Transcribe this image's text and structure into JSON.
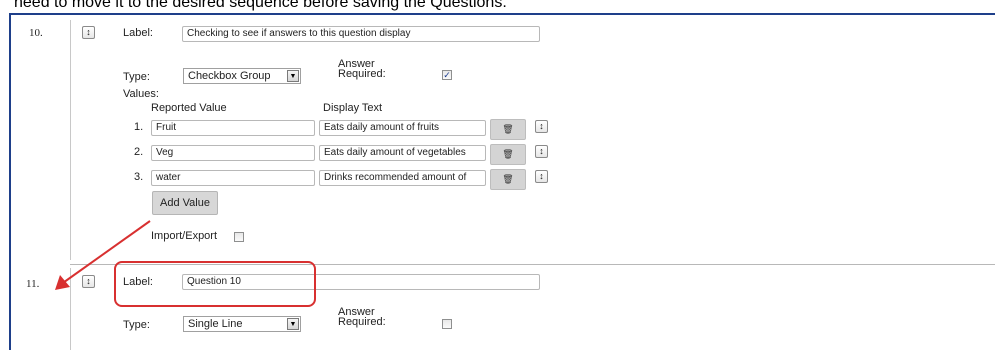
{
  "banner": {
    "text": "need to move it to the desired sequence before saving the Questions."
  },
  "icons": {
    "handle_icon": "updown-arrow-icon",
    "trash_icon": "trash-icon",
    "dropdown_icon": "chevron-down-icon"
  },
  "colors": {
    "annotation_red": "#d83030",
    "frame_blue": "#1e3f8a",
    "check_blue": "#1b3c8f"
  },
  "question10": {
    "number": "10.",
    "label_caption": "Label:",
    "label_value": "Checking to see if answers to this question display",
    "type_caption": "Type:",
    "type_value": "Checkbox Group",
    "answer_required_caption_line1": "Answer",
    "answer_required_caption_line2": "Required:",
    "answer_required_checked": true,
    "values_caption": "Values:",
    "col_reported": "Reported Value",
    "col_display": "Display Text",
    "rows": [
      {
        "num": "1.",
        "reported": "Fruit",
        "display": "Eats daily amount of fruits"
      },
      {
        "num": "2.",
        "reported": "Veg",
        "display": "Eats daily amount of vegetables"
      },
      {
        "num": "3.",
        "reported": "water",
        "display": "Drinks recommended amount of"
      }
    ],
    "add_value_label": "Add Value",
    "import_export_label": "Import/Export",
    "import_export_checked": false
  },
  "question11": {
    "number": "11.",
    "label_caption": "Label:",
    "label_value": "Question 10",
    "type_caption": "Type:",
    "type_value": "Single Line",
    "answer_required_caption_line1": "Answer",
    "answer_required_caption_line2": "Required:",
    "answer_required_checked": false
  }
}
